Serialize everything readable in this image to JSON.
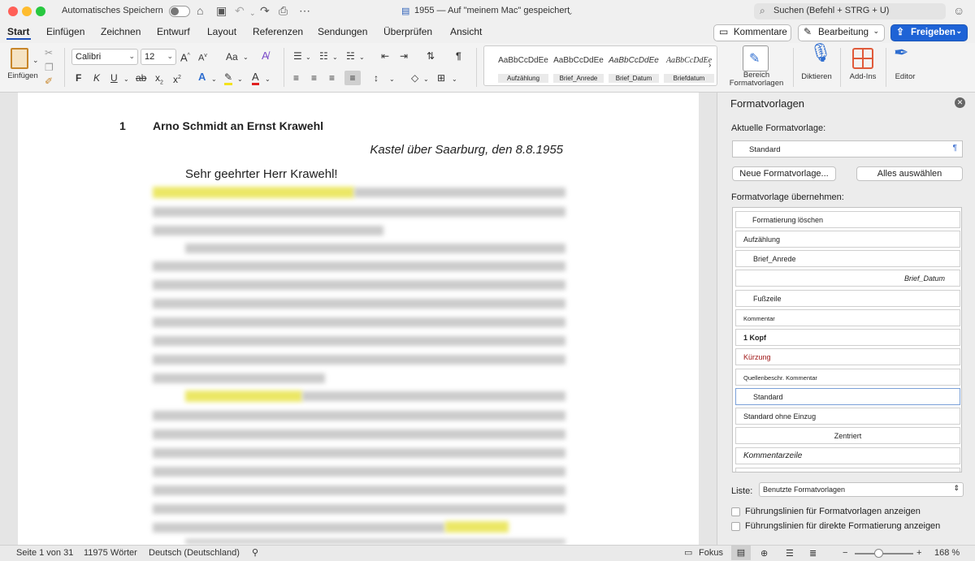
{
  "titlebar": {
    "autosave_label": "Automatisches Speichern",
    "doc_title": "1955 — Auf \"meinem Mac\" gespeichert",
    "search_placeholder": "Suchen (Befehl + STRG + U)"
  },
  "tabs": [
    "Start",
    "Einfügen",
    "Zeichnen",
    "Entwurf",
    "Layout",
    "Referenzen",
    "Sendungen",
    "Überprüfen",
    "Ansicht"
  ],
  "active_tab": "Start",
  "top_buttons": {
    "comments": "Kommentare",
    "editing": "Bearbeitung",
    "share": "Freigeben"
  },
  "ribbon": {
    "paste_label": "Einfügen",
    "font_name": "Calibri",
    "font_size": "12",
    "bold": "F",
    "italic": "K",
    "underline": "U",
    "strike": "ab",
    "sub": "x",
    "sup": "x",
    "grow": "A",
    "shrink": "A",
    "case": "Aa",
    "gallery": [
      {
        "sample": "AaBbCcDdEe",
        "name": "Aufzählung"
      },
      {
        "sample": "AaBbCcDdEe",
        "name": "Brief_Anrede"
      },
      {
        "sample": "AaBbCcDdEe",
        "name": "Brief_Datum"
      },
      {
        "sample": "AaBbCcDdEe",
        "name": "Briefdatum"
      }
    ],
    "styles_pane_label_1": "Bereich",
    "styles_pane_label_2": "Formatvorlagen",
    "dictate_label": "Diktieren",
    "addins_label": "Add-Ins",
    "editor_label": "Editor"
  },
  "document": {
    "heading_number": "1",
    "heading_text": "Arno Schmidt an Ernst Krawehl",
    "date_line": "Kastel über Saarburg, den 8.8.1955",
    "salutation": "Sehr geehrter Herr Krawehl!"
  },
  "pane": {
    "title": "Formatvorlagen",
    "current_label": "Aktuelle Formatvorlage:",
    "current_style": "Standard",
    "new_style_button": "Neue Formatvorlage...",
    "select_all_button": "Alles auswählen",
    "apply_label": "Formatvorlage übernehmen:",
    "styles": [
      "Formatierung löschen",
      "Aufzählung",
      "Brief_Anrede",
      "Brief_Datum",
      "Fußzeile",
      "Kommentar",
      "1  Kopf",
      "Kürzung",
      "Quellenbeschr. Kommentar",
      "Standard",
      "Standard ohne Einzug",
      "Zentriert",
      "Kommentarzeile"
    ],
    "list_label": "Liste:",
    "list_value": "Benutzte Formatvorlagen",
    "guide_styles": "Führungslinien für Formatvorlagen anzeigen",
    "guide_direct": "Führungslinien für direkte Formatierung anzeigen"
  },
  "status": {
    "page": "Seite 1 von 31",
    "words": "11975 Wörter",
    "language": "Deutsch (Deutschland)",
    "focus": "Fokus",
    "zoom_percent": "168 %",
    "zoom_level": 0.4
  },
  "colors": {
    "accent": "#1e63d6",
    "highlight": "#e8e34a",
    "red_style": "#a01818"
  }
}
